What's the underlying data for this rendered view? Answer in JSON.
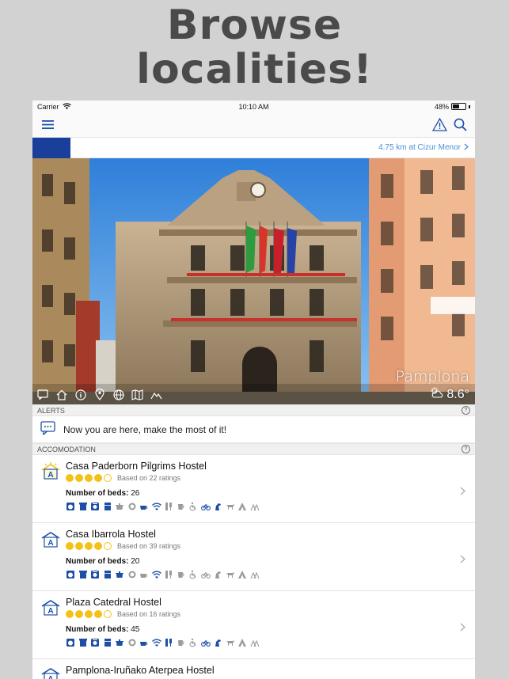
{
  "promo": {
    "line1": "Browse",
    "line2": "localities!"
  },
  "status_bar": {
    "carrier": "Carrier",
    "time": "10:10 AM",
    "battery": "48%"
  },
  "location_bar": {
    "distance": "4.75 km at Cizur Menor"
  },
  "hero": {
    "city": "Pamplona",
    "temperature": "8.6°"
  },
  "alerts": {
    "header": "ALERTS",
    "message": "Now you are here, make the most of it!"
  },
  "accommodation": {
    "header": "ACCOMODATION",
    "beds_label": "Number of beds:",
    "items": [
      {
        "name": "Casa Paderborn Pilgrims Hostel",
        "rating": 4,
        "ratings_text": "Based on 22 ratings",
        "beds": "26",
        "amenities": [
          1,
          1,
          1,
          1,
          0,
          0,
          1,
          1,
          0,
          0,
          0,
          1,
          1,
          0,
          0,
          0,
          0
        ]
      },
      {
        "name": "Casa Ibarrola Hostel",
        "rating": 4,
        "ratings_text": "Based on 39 ratings",
        "beds": "20",
        "amenities": [
          1,
          1,
          1,
          1,
          1,
          0,
          0,
          1,
          0,
          0,
          0,
          0,
          0,
          0,
          0,
          0,
          0
        ]
      },
      {
        "name": "Plaza Catedral Hostel",
        "rating": 4,
        "ratings_text": "Based on 16 ratings",
        "beds": "45",
        "amenities": [
          1,
          1,
          1,
          1,
          1,
          0,
          1,
          1,
          1,
          0,
          0,
          1,
          1,
          0,
          0,
          0,
          0
        ]
      },
      {
        "name": "Pamplona-Iruñako Aterpea Hostel"
      }
    ]
  },
  "colors": {
    "brand_blue": "#1a3f9a",
    "link_blue": "#4a8fd8",
    "star_yellow": "#f2c21b"
  }
}
